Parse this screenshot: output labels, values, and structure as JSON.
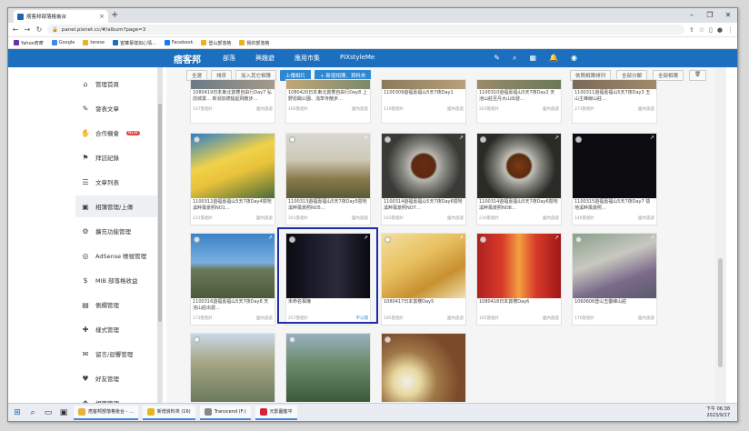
{
  "browser": {
    "tab_title": "痞客邦部落格後台",
    "url": "panel.pixnet.cc/#/album?page=3",
    "bookmarks": [
      "Yahoo奇摩",
      "Google",
      "terese",
      "崔蘿慕樣如心情...",
      "Facebook",
      "登山部落格",
      "我的部落格"
    ]
  },
  "header": {
    "logo": "痞客邦",
    "nav": [
      "部落",
      "興趣遊",
      "應用市集",
      "PIXstyleMe"
    ]
  },
  "sidebar": {
    "items": [
      {
        "label": "管理首頁",
        "icon": "home-icon"
      },
      {
        "label": "發表文章",
        "icon": "compose-icon"
      },
      {
        "label": "合作機會",
        "icon": "handshake-icon",
        "badge": "NEW"
      },
      {
        "label": "拜訪紀錄",
        "icon": "footprint-icon"
      },
      {
        "label": "文章列表",
        "icon": "list-icon"
      },
      {
        "label": "相簿管理/上傳",
        "icon": "photo-icon",
        "active": true
      },
      {
        "label": "擴充功能管理",
        "icon": "puzzle-icon"
      },
      {
        "label": "AdSense 帳號管理",
        "icon": "adsense-icon"
      },
      {
        "label": "MIB 部落格收益",
        "icon": "money-icon"
      },
      {
        "label": "側欄管理",
        "icon": "sidebar-icon"
      },
      {
        "label": "樣式管理",
        "icon": "style-icon"
      },
      {
        "label": "留言/迴響管理",
        "icon": "comment-icon"
      },
      {
        "label": "好友管理",
        "icon": "friend-icon"
      },
      {
        "label": "相簿管理",
        "icon": "album-icon"
      }
    ]
  },
  "toolbar": {
    "select_all": "全選",
    "share": "排序",
    "add_to_album": "加入其它相簿",
    "upload": "上傳相片",
    "new_album": "+ 新增相簿、資料夾",
    "sort_by": "依照相簿排列",
    "all_categories": "全部分類",
    "all_albums": "全部相簿"
  },
  "photos": [
    {
      "caption": "1080419日本東北賞櫻自由行Day7 弘前城賞… 新潟加德提起飛散步…",
      "info": "147張相片",
      "status": "國內旅遊"
    },
    {
      "caption": "1080420日本東北賞櫻自由行Day8 上野恩賜公園、浅草寺散步…",
      "info": "166張相片",
      "status": "國內旅遊"
    },
    {
      "caption": "1100309遊福嘉福山5天7夜Day1",
      "info": "119張相片",
      "status": "國內旅遊"
    },
    {
      "caption": "1100310遊福嘉福山5天7夜Day2 天池山莊至丹大山出發…",
      "info": "203張相片",
      "status": "國內旅遊"
    },
    {
      "caption": "1100311遊福嘉福山5天7夜Day3 玉山主峰線山莊…",
      "info": "273張相片",
      "status": "國內旅遊"
    },
    {
      "caption": "1100312遊福嘉福山5天7夜Day4營地溪畔風景照NO1…",
      "info": "231張相片",
      "status": "國內旅遊"
    },
    {
      "caption": "1100313遊福嘉福山5天7夜Day5營地溪畔風景照NO5…",
      "info": "201張相片",
      "status": "國內旅遊"
    },
    {
      "caption": "1100314遊福嘉福山5天7夜Day6營地溪畔風景照NO7…",
      "info": "203張相片",
      "status": "國內旅遊"
    },
    {
      "caption": "1100314遊福嘉福山5天7夜Day6營地溪畔風景照NO8…",
      "info": "230張相片",
      "status": "國內旅遊"
    },
    {
      "caption": "1100315遊福嘉福山5天7夜Day7 營地溪畔風景照…",
      "info": "146張相片",
      "status": "國內旅遊"
    },
    {
      "caption": "1100316遊福嘉福山5天7夜Day8 天池山莊出發…",
      "info": "173張相片",
      "status": "國內旅遊"
    },
    {
      "caption": "未命名相簿",
      "info": "257張相片",
      "status": "不公開",
      "selected": true
    },
    {
      "caption": "1080417日本賞櫻Day5",
      "info": "185張相片",
      "status": "國內旅遊"
    },
    {
      "caption": "1080418日本賞櫻Day6",
      "info": "185張相片",
      "status": "國內旅遊"
    },
    {
      "caption": "1060606登山玉靈峰山莊",
      "info": "176張相片",
      "status": "國內旅遊"
    }
  ],
  "taskbar": {
    "apps": [
      "痞客邦部落格後台 - ...",
      "新增資料夾 (16)",
      "Transcend (F:)",
      "元影圖客平"
    ],
    "time": "下午 06:38",
    "date": "2023/9/17"
  }
}
